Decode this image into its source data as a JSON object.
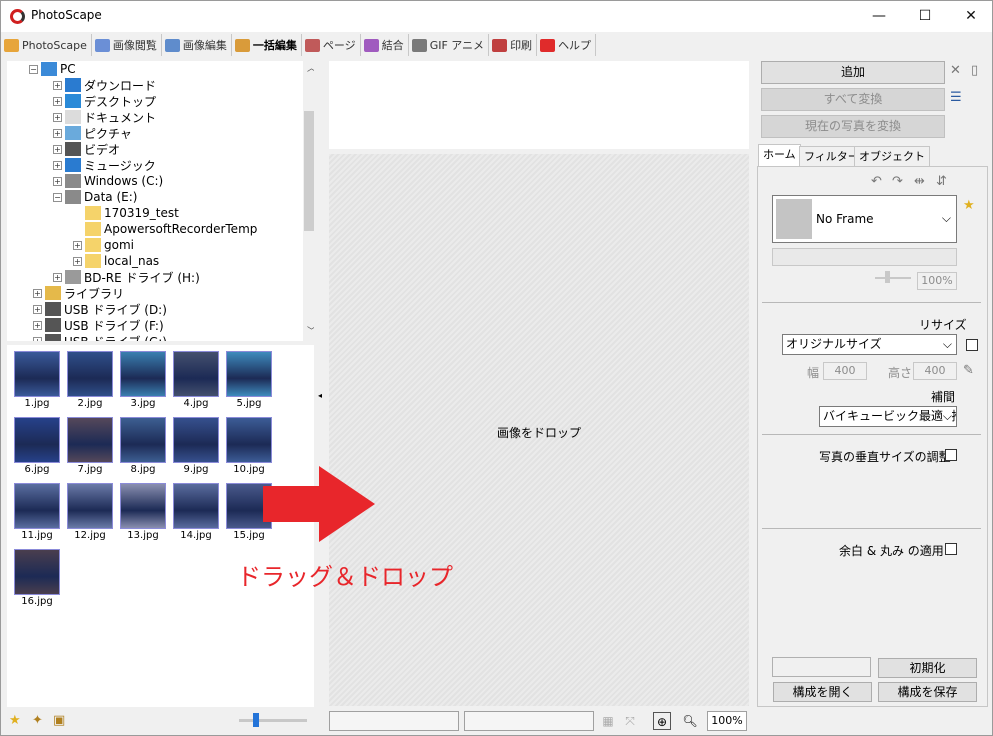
{
  "window": {
    "title": "PhotoScape",
    "minimize": "—",
    "maximize": "☐",
    "close": "✕"
  },
  "tabs": [
    {
      "label": "PhotoScape",
      "color": "#e7a53b"
    },
    {
      "label": "画像閲覧",
      "color": "#6b8fd6"
    },
    {
      "label": "画像編集",
      "color": "#5f8ccc"
    },
    {
      "label": "一括編集",
      "color": "#d99b3a",
      "active": true
    },
    {
      "label": "ページ",
      "color": "#c05a5a"
    },
    {
      "label": "結合",
      "color": "#a05bbf"
    },
    {
      "label": "GIF アニメ",
      "color": "#7a7a7a"
    },
    {
      "label": "印刷",
      "color": "#c04040"
    },
    {
      "label": "ヘルプ",
      "color": "#e02b2b"
    }
  ],
  "tree": {
    "nodes": [
      {
        "label": "PC",
        "icon": "pc-icon",
        "exp": "−"
      },
      {
        "label": "ダウンロード",
        "icon": "download-icon",
        "exp": "+"
      },
      {
        "label": "デスクトップ",
        "icon": "desktop-icon",
        "exp": "+"
      },
      {
        "label": "ドキュメント",
        "icon": "document-icon",
        "exp": "+"
      },
      {
        "label": "ピクチャ",
        "icon": "pictures-icon",
        "exp": "+"
      },
      {
        "label": "ビデオ",
        "icon": "video-icon",
        "exp": "+"
      },
      {
        "label": "ミュージック",
        "icon": "music-icon",
        "exp": "+"
      },
      {
        "label": "Windows (C:)",
        "icon": "drive-icon",
        "exp": "+"
      },
      {
        "label": "Data (E:)",
        "icon": "drive-icon",
        "exp": "−"
      },
      {
        "label": "170319_test",
        "icon": "folder-icon",
        "exp": ""
      },
      {
        "label": "ApowersoftRecorderTemp",
        "icon": "folder-icon",
        "exp": ""
      },
      {
        "label": "gomi",
        "icon": "folder-icon",
        "exp": "+"
      },
      {
        "label": "local_nas",
        "icon": "folder-icon",
        "exp": "+"
      },
      {
        "label": "BD-RE ドライブ (H:)",
        "icon": "bd-drive-icon",
        "exp": "+"
      },
      {
        "label": "ライブラリ",
        "icon": "library-icon",
        "exp": "+"
      },
      {
        "label": "USB ドライブ (D:)",
        "icon": "usb-drive-icon",
        "exp": "+"
      },
      {
        "label": "USB ドライブ (F:)",
        "icon": "usb-drive-icon",
        "exp": "+"
      },
      {
        "label": "USB ドライブ (G:)",
        "icon": "usb-drive-icon",
        "exp": "+"
      }
    ]
  },
  "thumbnails": [
    {
      "label": "1.jpg",
      "color": "#3a5a9a"
    },
    {
      "label": "2.jpg",
      "color": "#2f4f8a"
    },
    {
      "label": "3.jpg",
      "color": "#3a7fb0"
    },
    {
      "label": "4.jpg",
      "color": "#44506e"
    },
    {
      "label": "5.jpg",
      "color": "#3e8bbd"
    },
    {
      "label": "6.jpg",
      "color": "#26418a"
    },
    {
      "label": "7.jpg",
      "color": "#55485a"
    },
    {
      "label": "8.jpg",
      "color": "#3d5f92"
    },
    {
      "label": "9.jpg",
      "color": "#36508e"
    },
    {
      "label": "10.jpg",
      "color": "#3c5c96"
    },
    {
      "label": "11.jpg",
      "color": "#5a6ea0"
    },
    {
      "label": "12.jpg",
      "color": "#6a7aa8"
    },
    {
      "label": "13.jpg",
      "color": "#8a8fb0"
    },
    {
      "label": "14.jpg",
      "color": "#5a6c9e"
    },
    {
      "label": "15.jpg",
      "color": "#4a5a8c"
    },
    {
      "label": "16.jpg",
      "color": "#4a3e4e"
    }
  ],
  "center": {
    "drop_hint": "画像をドロップ",
    "annotation": "ドラッグ＆ドロップ",
    "annotation_color": "#e8262b",
    "zoom": "100%"
  },
  "right": {
    "add_button": "追加",
    "convert_all_button": "すべて変換",
    "convert_current_button": "現在の写真を変換",
    "tabs": [
      "ホーム",
      "フィルター",
      "オブジェクト"
    ],
    "frame": {
      "value": "No Frame"
    },
    "frame_percent": "100%",
    "resize_label": "リサイズ",
    "resize_value": "オリジナルサイズ",
    "width_label": "幅",
    "width_value": "400",
    "height_label": "高さ",
    "height_value": "400",
    "interp_label": "補間",
    "interp_value": "バイキュービック最適 (推",
    "vertical_adjust_label": "写真の垂直サイズの調整",
    "margin_round_label": "余白 & 丸み の適用",
    "reset_button": "初期化",
    "open_config_button": "構成を開く",
    "save_config_button": "構成を保存"
  }
}
